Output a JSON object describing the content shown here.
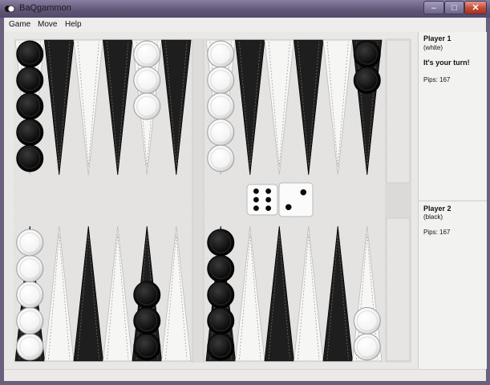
{
  "window": {
    "title": "BaQgammon",
    "minimize_glyph": "–",
    "maximize_glyph": "□",
    "close_glyph": "✕"
  },
  "menu": [
    {
      "label": "Game"
    },
    {
      "label": "Move"
    },
    {
      "label": "Help"
    }
  ],
  "players": {
    "player1": {
      "name": "Player 1",
      "color_label": "(white)",
      "turn_text": "It's your turn!",
      "pips": "Pips:  167"
    },
    "player2": {
      "name": "Player 2",
      "color_label": "(black)",
      "pips": "Pips:  167"
    }
  },
  "dice": [
    6,
    2
  ],
  "board": {
    "top_left_stacks": [
      {
        "point": 1,
        "color": "black",
        "count": 5
      },
      {
        "point": 5,
        "color": "white",
        "count": 3
      }
    ],
    "top_right_stacks": [
      {
        "point": 1,
        "color": "white",
        "count": 5
      },
      {
        "point": 6,
        "color": "black",
        "count": 2
      }
    ],
    "bottom_left_stacks": [
      {
        "point": 1,
        "color": "white",
        "count": 5
      },
      {
        "point": 5,
        "color": "black",
        "count": 3
      }
    ],
    "bottom_right_stacks": [
      {
        "point": 1,
        "color": "black",
        "count": 5
      },
      {
        "point": 6,
        "color": "white",
        "count": 2
      }
    ]
  },
  "colors": {
    "felt": "#e6e5e3",
    "dark_point": "#1e1e1e",
    "light_point": "#f6f6f4",
    "frame": "#d5d4d2"
  }
}
